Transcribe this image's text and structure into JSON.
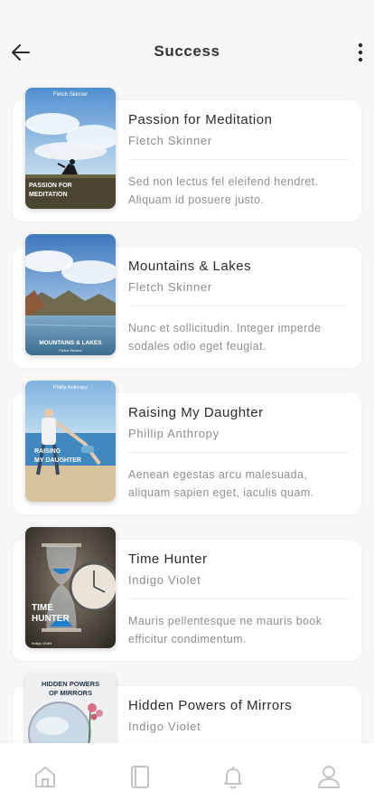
{
  "header": {
    "title": "Success",
    "back_icon": "arrow-left-icon",
    "more_icon": "more-vertical-icon"
  },
  "books": [
    {
      "title": "Passion for Meditation",
      "author": "Fletch Skinner",
      "description_lines": [
        "Sed non lectus fel eleifend hendret.",
        "Aliquam id posuere justo."
      ],
      "cover": {
        "top_text": "Fletch Skinner",
        "title_lines": [
          "PASSION FOR",
          "MEDITATION"
        ],
        "bottom_text": ""
      }
    },
    {
      "title": "Mountains & Lakes",
      "author": "Fletch Skinner",
      "description_lines": [
        "Nunc et sollicitudin. Integer imperde",
        "sodales odio eget feugiat."
      ],
      "cover": {
        "top_text": "",
        "title_lines": [
          "MOUNTAINS & LAKES"
        ],
        "bottom_text": "Fletch Skinner"
      }
    },
    {
      "title": "Raising My Daughter",
      "author": "Phillip Anthropy",
      "description_lines": [
        "Aenean egestas arcu malesuada,",
        "aliquam sapien eget, iaculis quam."
      ],
      "cover": {
        "top_text": "Phillip Anthropy",
        "title_lines": [
          "RAISING",
          "MY DAUGHTER"
        ],
        "bottom_text": ""
      }
    },
    {
      "title": "Time Hunter",
      "author": "Indigo Violet",
      "description_lines": [
        "Mauris pellentesque ne mauris book",
        "efficitur condimentum."
      ],
      "cover": {
        "top_text": "",
        "title_lines": [
          "TIME",
          "HUNTER"
        ],
        "bottom_text": "Indigo Violet"
      }
    },
    {
      "title": "Hidden Powers of Mirrors",
      "author": "Indigo Violet",
      "description_lines": [
        "",
        ""
      ],
      "cover": {
        "top_text": "",
        "title_lines": [
          "HIDDEN POWERS",
          "OF MIRRORS"
        ],
        "bottom_text": ""
      }
    }
  ],
  "tabbar": [
    {
      "icon": "home-icon",
      "active": false
    },
    {
      "icon": "book-icon",
      "active": false
    },
    {
      "icon": "bell-icon",
      "active": false
    },
    {
      "icon": "user-icon",
      "active": false
    }
  ],
  "colors": {
    "background": "#f7f7f7",
    "card": "#ffffff",
    "title_text": "#2b2b2b",
    "secondary_text": "#8c8c8c",
    "tab_icon": "#c4c4c4"
  }
}
